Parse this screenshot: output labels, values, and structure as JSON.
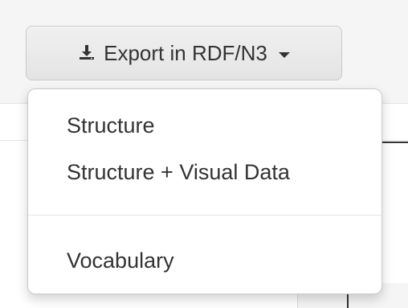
{
  "export_button": {
    "label": "Export in RDF/N3",
    "icon": "download-icon"
  },
  "dropdown": {
    "items": [
      {
        "label": "Structure"
      },
      {
        "label": "Structure + Visual Data"
      },
      {
        "label": "Vocabulary"
      }
    ]
  },
  "colors": {
    "text": "#333333",
    "button_bg": "#e8e8e8",
    "menu_bg": "#ffffff",
    "divider": "#e5e5e5"
  }
}
